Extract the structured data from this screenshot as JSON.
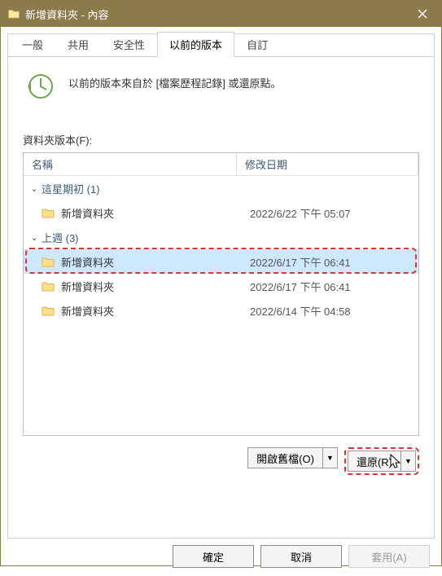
{
  "window": {
    "title": "新增資料夾 - 內容",
    "close_icon": "×"
  },
  "tabs": {
    "general": "一般",
    "sharing": "共用",
    "security": "安全性",
    "previous": "以前的版本",
    "custom": "自訂"
  },
  "hint": "以前的版本來自於 [檔案歷程記錄] 或還原點。",
  "section_label": "資料夾版本(F):",
  "columns": {
    "name": "名稱",
    "date": "修改日期"
  },
  "groups": [
    {
      "label": "這星期初 (1)",
      "items": [
        {
          "name": "新增資料夾",
          "date": "2022/6/22 下午 05:07",
          "selected": false
        }
      ]
    },
    {
      "label": "上週 (3)",
      "items": [
        {
          "name": "新增資料夾",
          "date": "2022/6/17 下午 06:41",
          "selected": true
        },
        {
          "name": "新增資料夾",
          "date": "2022/6/17 下午 06:41",
          "selected": false
        },
        {
          "name": "新增資料夾",
          "date": "2022/6/14 下午 04:58",
          "selected": false
        }
      ]
    }
  ],
  "buttons": {
    "open": "開啟舊檔(O)",
    "restore": "還原(R)",
    "ok": "確定",
    "cancel": "取消",
    "apply": "套用(A)"
  }
}
